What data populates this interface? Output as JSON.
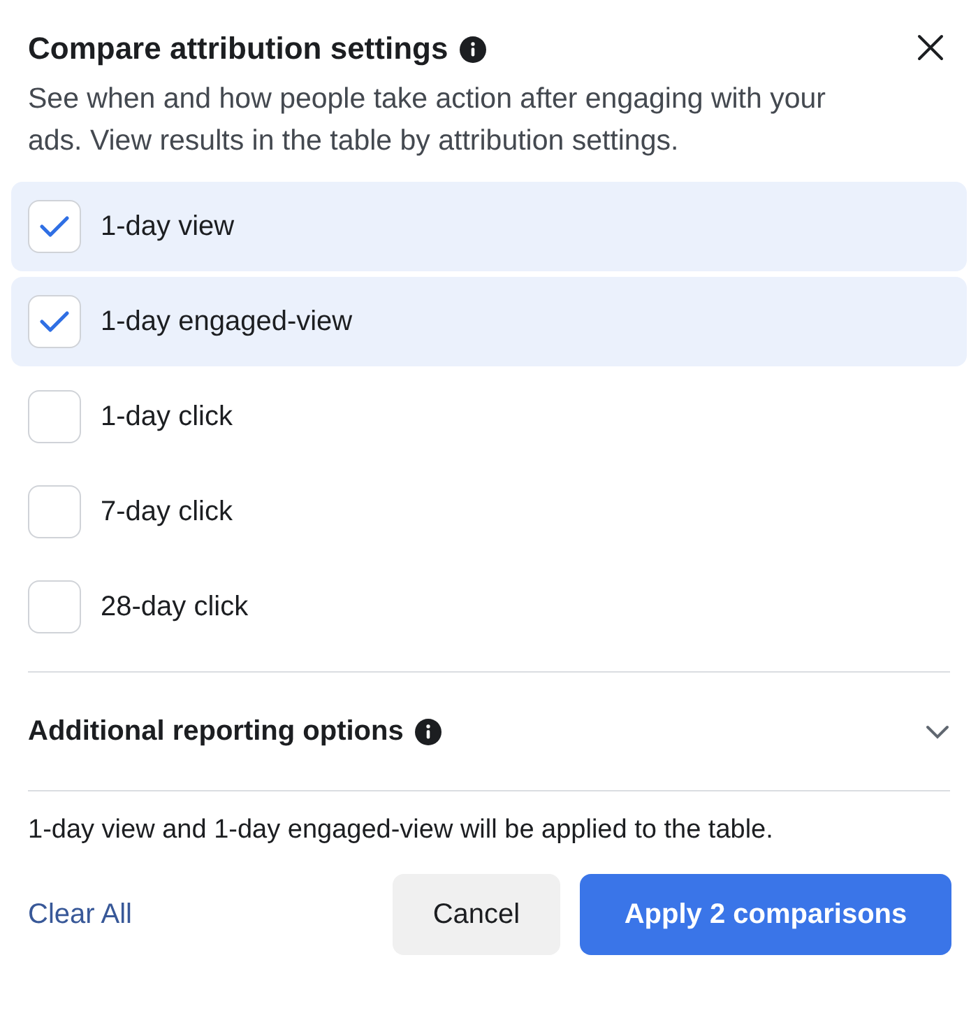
{
  "dialog": {
    "title": "Compare attribution settings",
    "description": "See when and how people take action after engaging with your ads. View results in the table by attribution settings."
  },
  "options": [
    {
      "label": "1-day view",
      "checked": true
    },
    {
      "label": "1-day engaged-view",
      "checked": true
    },
    {
      "label": "1-day click",
      "checked": false
    },
    {
      "label": "7-day click",
      "checked": false
    },
    {
      "label": "28-day click",
      "checked": false
    }
  ],
  "additional": {
    "label": "Additional reporting options",
    "expanded": false
  },
  "summary": "1-day view and 1-day engaged-view will be applied to the table.",
  "footer": {
    "clear": "Clear All",
    "cancel": "Cancel",
    "apply": "Apply 2 comparisons"
  }
}
